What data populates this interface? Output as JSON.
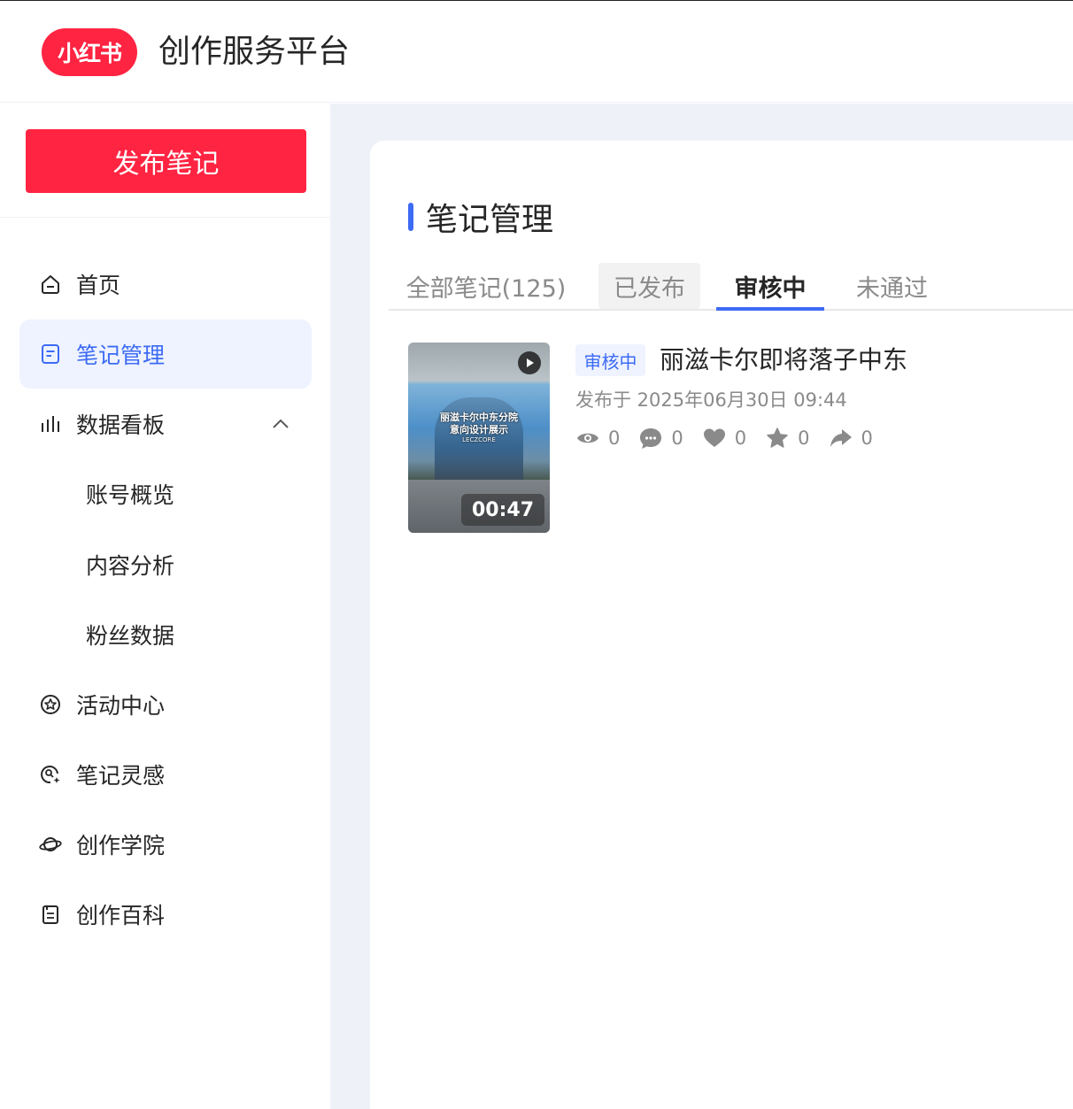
{
  "header": {
    "logo_text": "小红书",
    "app_title": "创作服务平台"
  },
  "sidebar": {
    "publish_label": "发布笔记",
    "items": [
      {
        "label": "首页",
        "icon": "home-icon"
      },
      {
        "label": "笔记管理",
        "icon": "note-icon",
        "active": true
      },
      {
        "label": "数据看板",
        "icon": "chart-icon",
        "expanded": true
      },
      {
        "label": "活动中心",
        "icon": "star-badge-icon"
      },
      {
        "label": "笔记灵感",
        "icon": "inspiration-icon"
      },
      {
        "label": "创作学院",
        "icon": "planet-icon"
      },
      {
        "label": "创作百科",
        "icon": "doc-icon"
      }
    ],
    "sub_items": [
      {
        "label": "账号概览"
      },
      {
        "label": "内容分析"
      },
      {
        "label": "粉丝数据"
      }
    ]
  },
  "main": {
    "section_title": "笔记管理",
    "tabs": [
      {
        "label": "全部笔记(125)"
      },
      {
        "label": "已发布"
      },
      {
        "label": "审核中",
        "active": true
      },
      {
        "label": "未通过"
      }
    ],
    "notes": [
      {
        "status": "审核中",
        "title": "丽滋卡尔即将落子中东",
        "time": "发布于 2025年06月30日 09:44",
        "duration": "00:47",
        "thumb_text_1": "丽滋卡尔中东分院",
        "thumb_text_2": "意向设计展示",
        "thumb_text_3": "LECZCORE",
        "stats": {
          "views": "0",
          "comments": "0",
          "likes": "0",
          "favorites": "0",
          "shares": "0"
        }
      }
    ]
  },
  "colors": {
    "brand_red": "#ff2442",
    "accent_blue": "#3d6bf4",
    "main_bg": "#eef1f8"
  }
}
